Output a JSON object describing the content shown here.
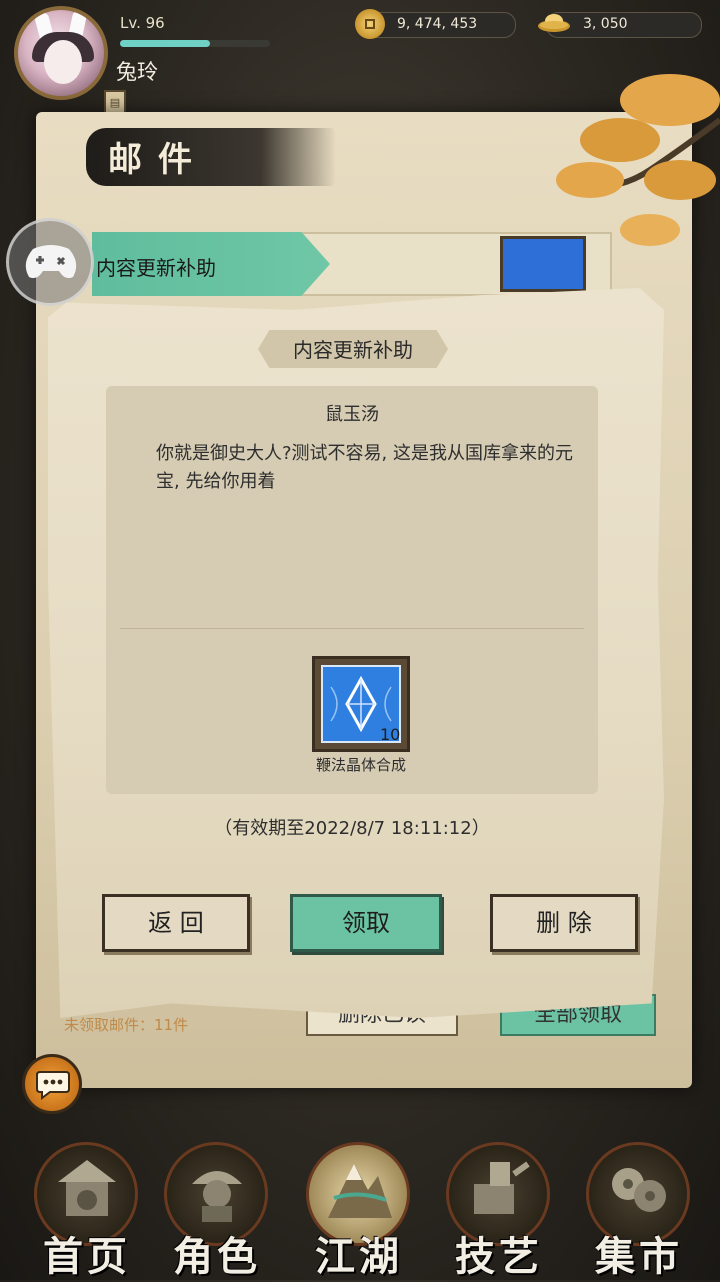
{
  "player": {
    "level": "Lv. 96",
    "name": "兔玲",
    "exp_fraction": 0.6
  },
  "currencies": {
    "coins": "9, 474, 453",
    "ingots": "3, 050"
  },
  "mail_screen": {
    "title": "邮件",
    "mail_item_label": "内容更新补助",
    "unclaimed_text": "未领取邮件：11件",
    "delete_read_label": "删除已读",
    "claim_all_label": "全部领取"
  },
  "modal": {
    "title": "内容更新补助",
    "sender": "鼠玉汤",
    "message": "你就是御史大人?测试不容易, 这是我从国库拿来的元宝, 先给你用着",
    "item": {
      "name": "鞭法晶体合成",
      "quantity": "10"
    },
    "expiry": "（有效期至2022/8/7  18:11:12）",
    "buttons": {
      "back": "返 回",
      "claim": "领取",
      "delete": "删 除"
    }
  },
  "nav": [
    {
      "label": "首页",
      "icon": "home-icon"
    },
    {
      "label": "角色",
      "icon": "character-icon"
    },
    {
      "label": "江湖",
      "icon": "jianghu-icon"
    },
    {
      "label": "技艺",
      "icon": "skill-icon"
    },
    {
      "label": "集市",
      "icon": "market-icon"
    }
  ],
  "colors": {
    "accent_green": "#6cc3a4",
    "paper": "#ece3ce",
    "gold": "#c9962e"
  }
}
